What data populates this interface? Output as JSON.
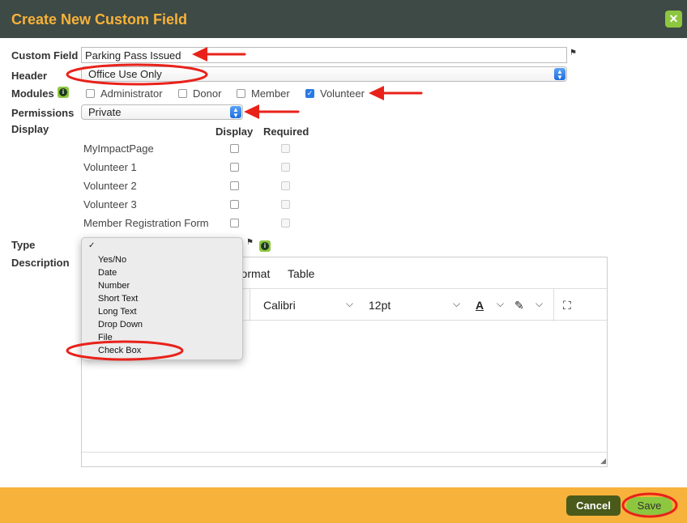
{
  "dialog": {
    "title": "Create New Custom Field",
    "close_icon": "close-icon"
  },
  "form": {
    "custom_field_label": "Custom Field",
    "custom_field_value": "Parking Pass Issued",
    "header_label": "Header",
    "header_value": "Office Use Only",
    "modules_label": "Modules",
    "modules": [
      {
        "label": "Administrator",
        "checked": false
      },
      {
        "label": "Donor",
        "checked": false
      },
      {
        "label": "Member",
        "checked": false
      },
      {
        "label": "Volunteer",
        "checked": true
      }
    ],
    "permissions_label": "Permissions",
    "permissions_value": "Private",
    "display_label": "Display",
    "display_col": "Display",
    "required_col": "Required",
    "display_rows": [
      {
        "label": "MyImpactPage"
      },
      {
        "label": "Volunteer 1"
      },
      {
        "label": "Volunteer 2"
      },
      {
        "label": "Volunteer 3"
      },
      {
        "label": "Member Registration Form"
      }
    ],
    "type_label": "Type",
    "description_label": "Description"
  },
  "type_dropdown": {
    "check_mark": "✓",
    "options": [
      "Yes/No",
      "Date",
      "Number",
      "Short Text",
      "Long Text",
      "Drop Down",
      "File",
      "Check Box"
    ]
  },
  "editor": {
    "menu": {
      "format": "Format",
      "table": "Table"
    },
    "font": "Calibri",
    "size": "12pt"
  },
  "footer": {
    "cancel": "Cancel",
    "save": "Save"
  },
  "colors": {
    "title_bar": "#3e4a45",
    "accent_orange": "#f7b23b",
    "green": "#8dc63f",
    "annotation_red": "#e8221a"
  }
}
